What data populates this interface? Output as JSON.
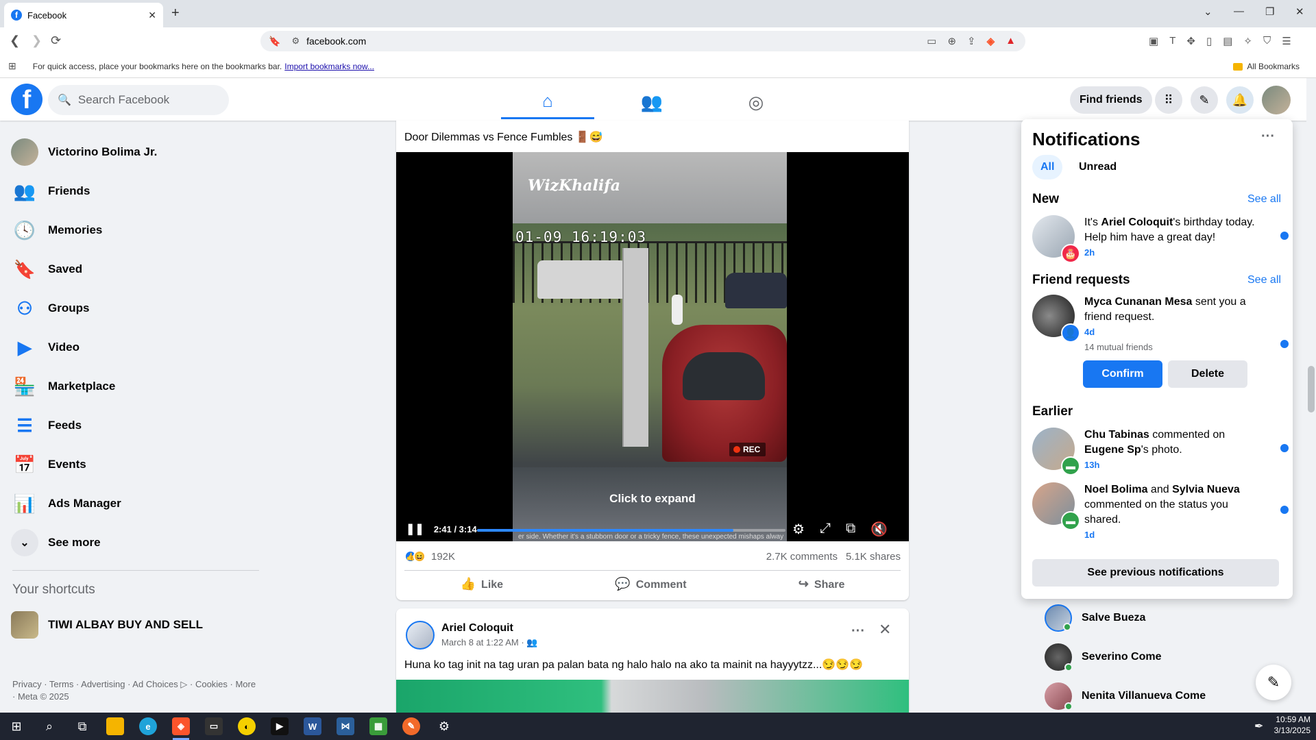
{
  "browser": {
    "tab_title": "Facebook",
    "url": "facebook.com",
    "bookmarks_hint": "For quick access, place your bookmarks here on the bookmarks bar.",
    "import_link": "Import bookmarks now...",
    "all_bookmarks": "All Bookmarks"
  },
  "fb_nav": {
    "logo": "f",
    "search_placeholder": "Search Facebook",
    "find_friends": "Find friends"
  },
  "sidebar": {
    "profile_name": "Victorino Bolima Jr.",
    "items": [
      {
        "label": "Friends",
        "icon": "friends-icon"
      },
      {
        "label": "Memories",
        "icon": "memories-icon"
      },
      {
        "label": "Saved",
        "icon": "saved-icon"
      },
      {
        "label": "Groups",
        "icon": "groups-icon"
      },
      {
        "label": "Video",
        "icon": "video-icon"
      },
      {
        "label": "Marketplace",
        "icon": "marketplace-icon"
      },
      {
        "label": "Feeds",
        "icon": "feeds-icon"
      },
      {
        "label": "Events",
        "icon": "events-icon"
      },
      {
        "label": "Ads Manager",
        "icon": "ads-manager-icon"
      }
    ],
    "see_more": "See more",
    "shortcuts_title": "Your shortcuts",
    "shortcut": "TIWI ALBAY BUY AND SELL",
    "footer": "Privacy · Terms · Advertising · Ad Choices ▷ · Cookies · More · Meta © 2025"
  },
  "post1": {
    "text": "Door Dilemmas vs Fence Fumbles 🚪😅",
    "watermark": "WizKhalifa",
    "timestamp_overlay": "01-09 16:19:03",
    "rec_label": "REC",
    "click_to_expand": "Click to expand",
    "video_time": "2:41 / 3:14",
    "progress": 0.83,
    "caption_strip": "er side. Whether it's a stubborn door or a tricky fence, these unexpected mishaps alway",
    "reactions": "192K",
    "comments": "2.7K comments",
    "shares": "5.1K shares",
    "like_label": "Like",
    "comment_label": "Comment",
    "share_label": "Share"
  },
  "post2": {
    "author": "Ariel Coloquit",
    "meta": "March 8 at 1:22 AM ·",
    "text": "Huna ko tag init  na tag  uran  pa palan  bata ng halo halo na ako ta mainit  na hayyytzz...😏😏😏"
  },
  "notifications": {
    "title": "Notifications",
    "filter_all": "All",
    "filter_unread": "Unread",
    "new_title": "New",
    "see_all": "See all",
    "birthday": {
      "pre": "It's ",
      "name": "Ariel Coloquit",
      "post": "'s birthday today. Help him have a great day!",
      "time": "2h"
    },
    "friend_requests_title": "Friend requests",
    "request": {
      "name": "Myca Cunanan Mesa",
      "post": " sent you a friend request.",
      "time": "4d",
      "mutual": "14 mutual friends",
      "confirm": "Confirm",
      "delete": "Delete"
    },
    "earlier_title": "Earlier",
    "earlier": [
      {
        "name": "Chu Tabinas",
        "mid": " commented on ",
        "name2": "Eugene Sp",
        "post": "'s photo.",
        "time": "13h"
      },
      {
        "name": "Noel Bolima",
        "mid": " and ",
        "name2": "Sylvia Nueva",
        "post": " commented on the status you shared.",
        "time": "1d"
      }
    ],
    "see_previous": "See previous notifications"
  },
  "contacts": [
    {
      "name": "Salve Bueza"
    },
    {
      "name": "Severino Come"
    },
    {
      "name": "Nenita Villanueva Come"
    }
  ],
  "taskbar": {
    "time": "10:59 AM",
    "date": "3/13/2025"
  },
  "colors": {
    "fb_blue": "#1877f2",
    "online_green": "#31a24c"
  }
}
